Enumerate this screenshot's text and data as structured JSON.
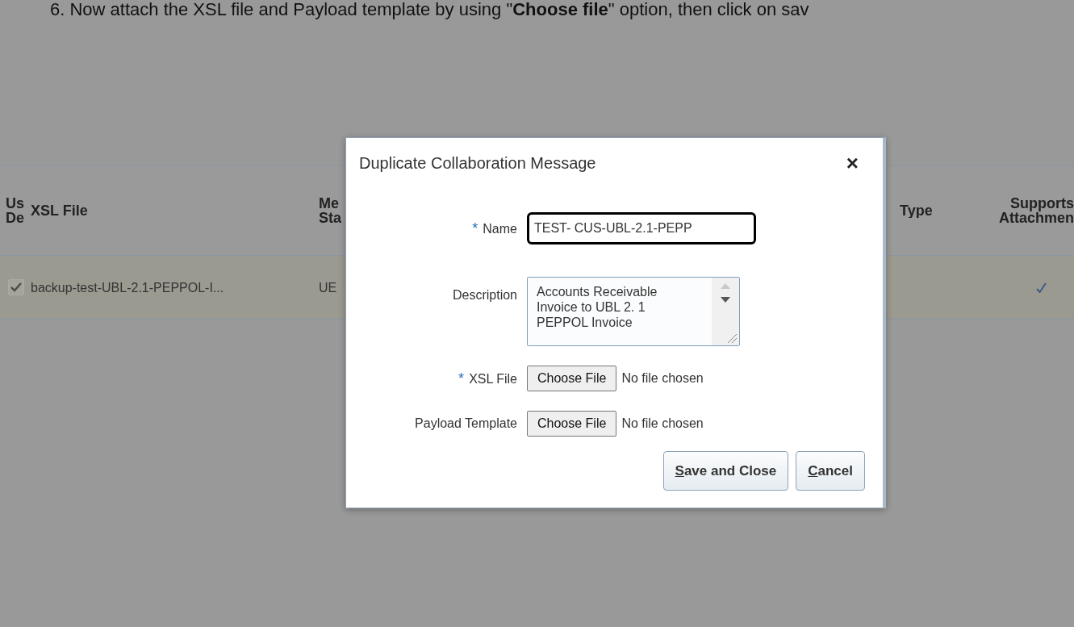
{
  "instruction": "6.  Now attach the XSL file and Payload template by using \"**Choose file**\" option, then click on sav",
  "table": {
    "columns": [
      {
        "lines": [
          "Us",
          "De"
        ],
        "kind": "checkbox"
      },
      {
        "lines": [
          "XSL File"
        ],
        "kind": "text"
      },
      {
        "lines": [
          "Me",
          "Sta"
        ],
        "kind": "text"
      },
      {
        "lines": [
          "Type"
        ],
        "kind": "text"
      },
      {
        "lines": [
          "Supports",
          "Attachmen"
        ],
        "kind": "check"
      }
    ],
    "rows": [
      {
        "checked": true,
        "xsl_file": "backup-test-UBL-2.1-PEPPOL-I...",
        "column_3": "UE",
        "supports_attachments": true
      }
    ]
  },
  "dialog": {
    "title": "Duplicate Collaboration Message",
    "close": "×",
    "fields": [
      {
        "kind": "text",
        "label": "Name",
        "required_mark": "*",
        "value": "TEST- CUS-UBL-2.1-PEPP",
        "focused": true
      },
      {
        "kind": "textarea",
        "label": "Description",
        "value": "Accounts Receivable Invoice to UBL 2. 1 PEPPOL Invoice"
      },
      {
        "kind": "file",
        "label": "XSL File",
        "required_mark": "*",
        "button": "Choose File",
        "status": "No file chosen"
      },
      {
        "kind": "file",
        "label": "Payload Template",
        "button": "Choose File",
        "status": "No file chosen"
      }
    ],
    "buttons": [
      {
        "mnemonic": "S",
        "rest": "ave and Close"
      },
      {
        "mnemonic": "C",
        "rest": "ancel"
      }
    ]
  }
}
